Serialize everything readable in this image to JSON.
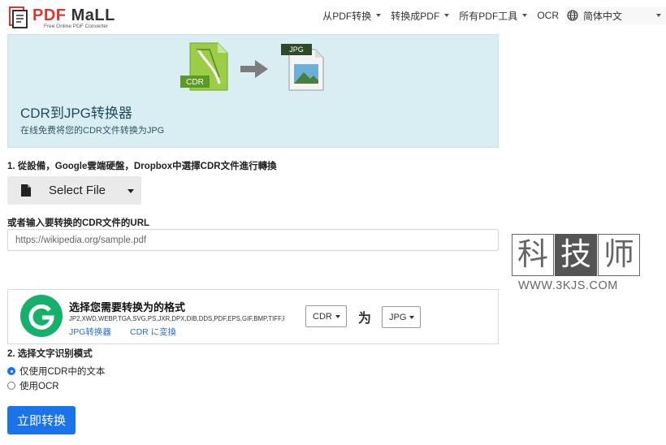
{
  "header": {
    "logo_pdf": "PDF",
    "logo_mall": "MaLL",
    "logo_tagline": "Free Online PDF Converter",
    "nav": [
      {
        "label": "从PDF转换"
      },
      {
        "label": "转换成PDF"
      },
      {
        "label": "所有PDF工具"
      }
    ],
    "ocr_label": "OCR",
    "language": "简体中文"
  },
  "hero": {
    "from_format": "CDR",
    "to_format": "JPG",
    "title": "CDR到JPG转换器",
    "subtitle": "在线免费将您的CDR文件转换为JPG"
  },
  "step1": {
    "label": "1. 從設備，Google雲端硬盤，Dropbox中選擇CDR文件進行轉換",
    "select_label": "Select File",
    "url_label": "或者输入要转换的CDR文件的URL",
    "url_placeholder": "https://wikipedia.org/sample.pdf"
  },
  "watermark": {
    "chars": [
      "科",
      "技",
      "师"
    ],
    "url": "WWW.3KJS.COM"
  },
  "format": {
    "title": "选择您需要转换为的格式",
    "list": "JP2,XWD,WEBP,TGA,SVG,PS,JXR,DPX,DIB,DDS,PDF,EPS,GIF,BMP,TIFF,P",
    "link1": "JPG转换器",
    "link2": "CDR に変換",
    "from": "CDR",
    "word": "为",
    "to": "JPG"
  },
  "step2": {
    "label": "2. 选择文字识别模式",
    "options": [
      "仅使用CDR中的文本",
      "使用OCR"
    ],
    "selected_index": 0
  },
  "convert_label": "立即转换",
  "colors": {
    "hero_bg": "#d8eef2",
    "primary": "#1a73e8",
    "link": "#2b6ec2",
    "logo_red": "#e0352b",
    "g_green": "#15b16b"
  }
}
